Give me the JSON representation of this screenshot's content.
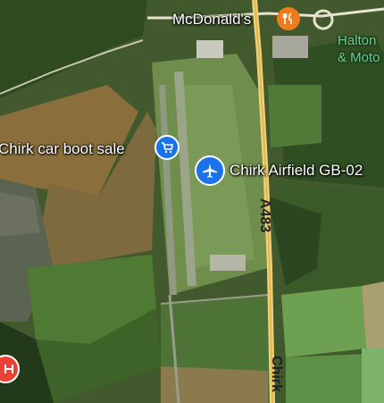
{
  "map": {
    "pois": [
      {
        "label": "McDonald's",
        "icon": "restaurant-icon",
        "color": "#f07b1d"
      },
      {
        "label": "Chirk car boot sale",
        "icon": "shopping-cart-icon",
        "color": "#1a73e8"
      },
      {
        "label": "Chirk Airfield GB-02",
        "icon": "airport-icon",
        "color": "#1a73e8"
      },
      {
        "label": "",
        "icon": "hospital-icon",
        "color": "#e94235"
      }
    ],
    "place_labels": {
      "line1": "Halton",
      "line2": "& Moto"
    },
    "roads": {
      "a483": "A483",
      "chirk": "Chirk"
    }
  }
}
